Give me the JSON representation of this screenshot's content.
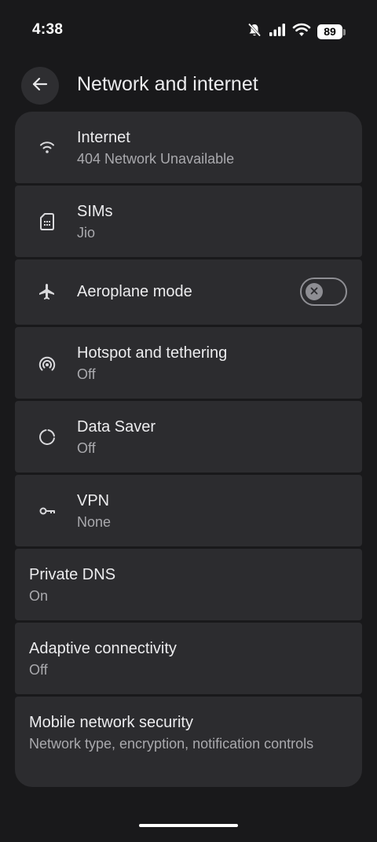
{
  "status_bar": {
    "time": "4:38",
    "battery": "89",
    "icons": [
      "mute-icon",
      "signal-icon",
      "wifi-icon",
      "battery-icon"
    ]
  },
  "header": {
    "title": "Network and internet",
    "back_icon": "arrow-back-icon"
  },
  "settings": [
    {
      "icon": "wifi-icon",
      "title": "Internet",
      "subtitle": "404 Network Unavailable"
    },
    {
      "icon": "sim-card-icon",
      "title": "SIMs",
      "subtitle": "Jio"
    },
    {
      "icon": "airplane-icon",
      "title": "Aeroplane mode",
      "toggle_on": false
    },
    {
      "icon": "hotspot-icon",
      "title": "Hotspot and tethering",
      "subtitle": "Off"
    },
    {
      "icon": "data-saver-icon",
      "title": "Data Saver",
      "subtitle": "Off"
    },
    {
      "icon": "vpn-key-icon",
      "title": "VPN",
      "subtitle": "None"
    },
    {
      "title": "Private DNS",
      "subtitle": "On"
    },
    {
      "title": "Adaptive connectivity",
      "subtitle": "Off"
    },
    {
      "title": "Mobile network security",
      "subtitle": "Network type, encryption, notification controls"
    }
  ],
  "colors": {
    "background": "#19191b",
    "card": "#2c2c2f",
    "title_text": "#ececee",
    "subtitle_text": "#a9a9ad",
    "toggle_off": "#8e8e93"
  }
}
